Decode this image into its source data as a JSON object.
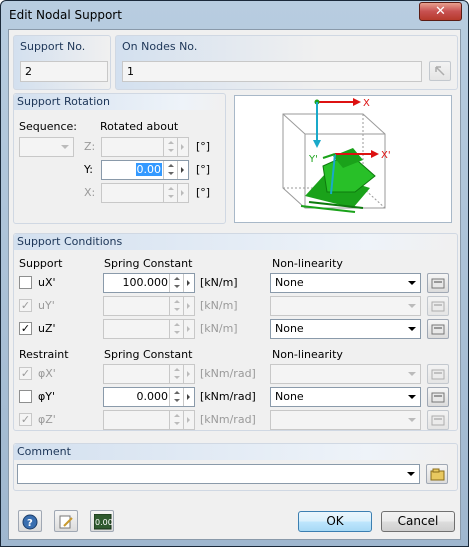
{
  "window": {
    "title": "Edit Nodal Support",
    "close_glyph": "✕"
  },
  "support_no": {
    "label": "Support No.",
    "value": "2"
  },
  "on_nodes": {
    "label": "On Nodes No.",
    "value": "1"
  },
  "rotation": {
    "title": "Support Rotation",
    "sequence_label": "Sequence:",
    "rotated_about_label": "Rotated about",
    "rows": [
      {
        "axis": "Z:",
        "value": "",
        "unit": "[°]",
        "enabled": false
      },
      {
        "axis": "Y:",
        "value": "0.00",
        "unit": "[°]",
        "enabled": true
      },
      {
        "axis": "X:",
        "value": "",
        "unit": "[°]",
        "enabled": false
      }
    ]
  },
  "preview": {
    "axis_x": "X",
    "axis_x_prime": "X'",
    "axis_y_prime": "Y'",
    "colors": {
      "green": "#1aa21a",
      "red": "#d11",
      "cyan": "#19a9c9",
      "box": "#9a9a9a"
    }
  },
  "conditions": {
    "title": "Support Conditions",
    "support_header": "Support",
    "spring_header": "Spring Constant",
    "nonlin_header": "Non-linearity",
    "support_rows": [
      {
        "name": "uX'",
        "checked": false,
        "enabled": true,
        "value": "100.000",
        "unit": "[kN/m]",
        "nonlin": "None"
      },
      {
        "name": "uY'",
        "checked": true,
        "enabled": false,
        "value": "",
        "unit": "[kN/m]",
        "nonlin": ""
      },
      {
        "name": "uZ'",
        "checked": true,
        "enabled": true,
        "value": "",
        "unit": "[kN/m]",
        "nonlin": "None"
      }
    ],
    "restraint_header": "Restraint",
    "restraint_spring_header": "Spring Constant",
    "restraint_nonlin_header": "Non-linearity",
    "restraint_rows": [
      {
        "name": "φX'",
        "checked": true,
        "enabled": false,
        "value": "",
        "unit": "[kNm/rad]",
        "nonlin": ""
      },
      {
        "name": "φY'",
        "checked": false,
        "enabled": true,
        "value": "0.000",
        "unit": "[kNm/rad]",
        "nonlin": "None"
      },
      {
        "name": "φZ'",
        "checked": true,
        "enabled": false,
        "value": "",
        "unit": "[kNm/rad]",
        "nonlin": ""
      }
    ]
  },
  "comment": {
    "title": "Comment",
    "value": ""
  },
  "buttons": {
    "ok": "OK",
    "cancel": "Cancel",
    "calc_icon_text": "0.00"
  }
}
